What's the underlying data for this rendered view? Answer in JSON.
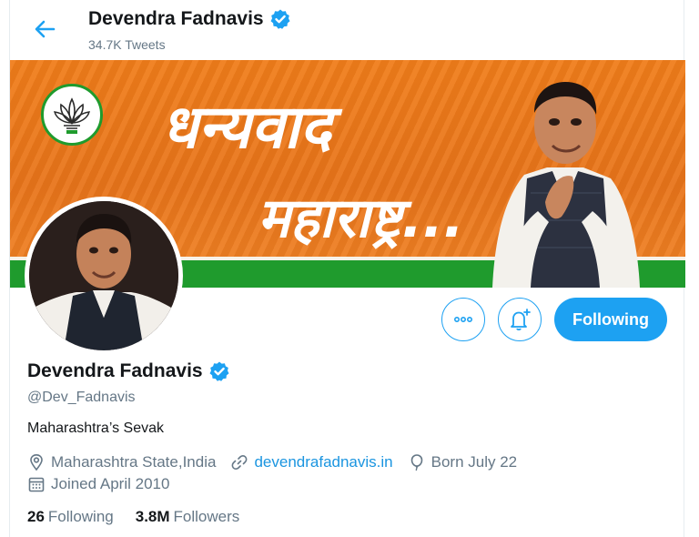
{
  "header": {
    "name": "Devendra Fadnavis",
    "tweet_count": "34.7K Tweets"
  },
  "banner": {
    "line1": "धन्यवाद",
    "line2": "महाराष्ट्र..."
  },
  "actions": {
    "follow_label": "Following"
  },
  "profile": {
    "name": "Devendra Fadnavis",
    "handle": "@Dev_Fadnavis",
    "bio": "Maharashtra’s Sevak",
    "location": "Maharashtra State,India",
    "website": "devendrafadnavis.in",
    "birthday": "Born July 22",
    "joined": "Joined April 2010"
  },
  "stats": {
    "following_count": "26",
    "following_label": "Following",
    "followers_count": "3.8M",
    "followers_label": "Followers"
  },
  "colors": {
    "accent": "#1da1f2",
    "link": "#1b95e0",
    "muted": "#657786",
    "banner_orange": "#ec7a1c",
    "banner_green": "#1f9b2d"
  },
  "icons": [
    "back-arrow-icon",
    "verified-badge-icon",
    "more-options-icon",
    "bell-plus-icon",
    "location-pin-icon",
    "link-icon",
    "balloon-icon",
    "calendar-icon",
    "bjp-lotus-logo"
  ]
}
